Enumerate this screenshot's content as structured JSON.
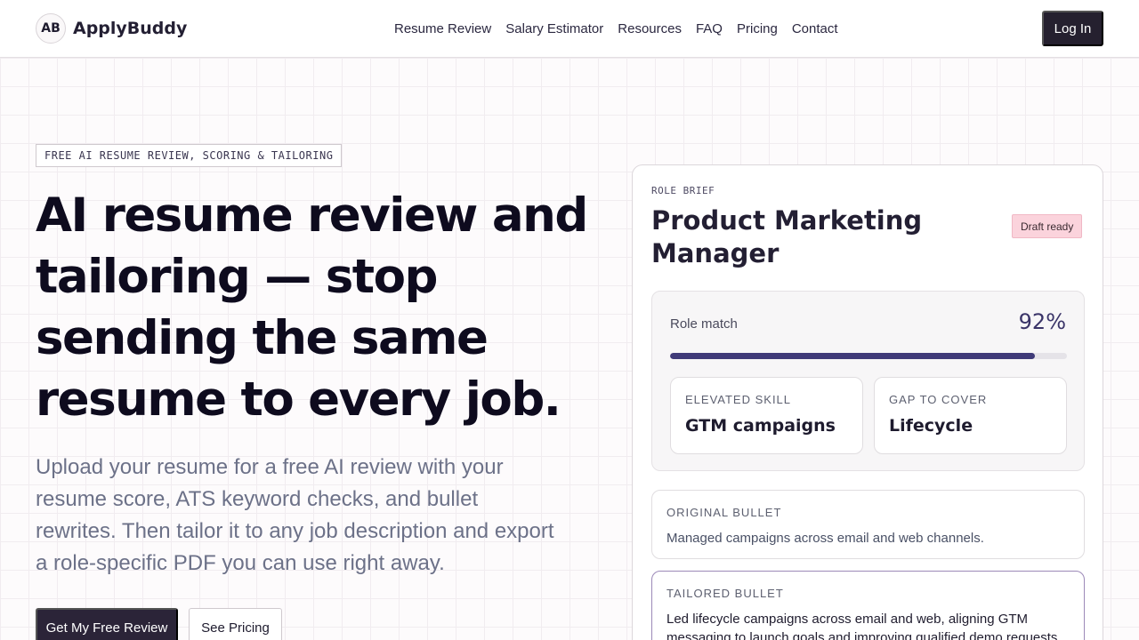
{
  "brand": {
    "logo_mark": "AB",
    "name": "ApplyBuddy"
  },
  "nav": {
    "links": [
      "Resume Review",
      "Salary Estimator",
      "Resources",
      "FAQ",
      "Pricing",
      "Contact"
    ],
    "login_label": "Log In"
  },
  "hero": {
    "eyebrow": "FREE AI RESUME REVIEW, SCORING & TAILORING",
    "title": "AI resume review and tailoring — stop sending the same resume to every job.",
    "subtitle": "Upload your resume for a free AI review with your resume score, ATS keyword checks, and bullet rewrites. Then tailor it to any job description and export a role-specific PDF you can use right away.",
    "primary_cta": "Get My Free Review",
    "secondary_cta": "See Pricing"
  },
  "role_card": {
    "eyebrow": "ROLE BRIEF",
    "title": "Product Marketing Manager",
    "badge": "Draft ready",
    "match_label": "Role match",
    "match_value": "92%",
    "match_fraction": 0.92,
    "elevated_skill_label": "ELEVATED SKILL",
    "elevated_skill_value": "GTM campaigns",
    "gap_label": "GAP TO COVER",
    "gap_value": "Lifecycle",
    "original_bullet_label": "ORIGINAL BULLET",
    "original_bullet_text": "Managed campaigns across email and web channels.",
    "tailored_bullet_label": "TAILORED BULLET",
    "tailored_bullet_text": "Led lifecycle campaigns across email and web, aligning GTM messaging to launch goals and improving qualified demo requests"
  },
  "colors": {
    "primary_dark": "#25202f",
    "accent_purple": "#3f3a78",
    "badge_pink": "#fbd3dc",
    "tailored_border": "#9c89b8"
  }
}
